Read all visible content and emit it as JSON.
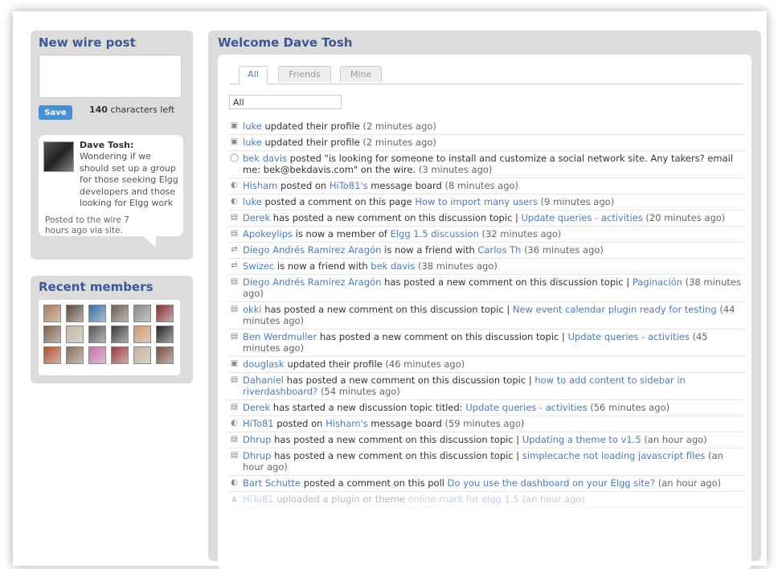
{
  "wire": {
    "title": "New wire post",
    "save_label": "Save",
    "char_count": "140",
    "char_label": "characters left",
    "post": {
      "author": "Dave Tosh:",
      "text": "Wondering if we should set up a group for those seeking Elgg developers and those looking for Elgg work",
      "meta": "Posted to the wire 7 hours ago via site."
    }
  },
  "members": {
    "title": "Recent members",
    "avatars": [
      "#a67b5b",
      "#5b4a3a",
      "#3a6ea5",
      "#6b5d4f",
      "#888888",
      "#8b2e2e",
      "#7a6048",
      "#c2b8a3",
      "#555555",
      "#3a3a3a",
      "#d09a6a",
      "#222222",
      "#b44d2e",
      "#8a6f5a",
      "#c96fa8",
      "#9a3a3a",
      "#c9b29a",
      "#7a4a3a"
    ]
  },
  "main": {
    "title": "Welcome Dave Tosh",
    "tabs": [
      "All",
      "Friends",
      "Mine"
    ],
    "filter_value": "All"
  },
  "feed": [
    {
      "icon": "profile-icon",
      "glyph": "▣",
      "parts": [
        {
          "l": "luke"
        },
        {
          "t": " updated their profile "
        },
        {
          "ts": "(2 minutes ago)"
        }
      ]
    },
    {
      "icon": "profile-icon",
      "glyph": "▣",
      "parts": [
        {
          "l": "luke"
        },
        {
          "t": " updated their profile "
        },
        {
          "ts": "(2 minutes ago)"
        }
      ]
    },
    {
      "icon": "wire-icon",
      "glyph": "◯",
      "parts": [
        {
          "l": "bek davis"
        },
        {
          "t": " posted \"is looking for someone to install and customize a social network site. Any takers? email me: bek@bekdavis.com\" on the wire. "
        },
        {
          "ts": "(3 minutes ago)"
        }
      ]
    },
    {
      "icon": "comment-icon",
      "glyph": "◐",
      "parts": [
        {
          "l": "Hisham"
        },
        {
          "t": " posted on "
        },
        {
          "l": "HiTo81's"
        },
        {
          "t": " message board "
        },
        {
          "ts": "(8 minutes ago)"
        }
      ]
    },
    {
      "icon": "comment-icon",
      "glyph": "◐",
      "parts": [
        {
          "l": "luke"
        },
        {
          "t": " posted a comment on this page "
        },
        {
          "l": "How to import many users"
        },
        {
          "t": " "
        },
        {
          "ts": "(9 minutes ago)"
        }
      ]
    },
    {
      "icon": "discussion-icon",
      "glyph": "▤",
      "parts": [
        {
          "l": "Derek"
        },
        {
          "t": " has posted a new comment on this discussion topic | "
        },
        {
          "l": "Update queries - activities"
        },
        {
          "t": " "
        },
        {
          "ts": "(20 minutes ago)"
        }
      ]
    },
    {
      "icon": "group-icon",
      "glyph": "▤",
      "parts": [
        {
          "l": "Apokeylips"
        },
        {
          "t": " is now a member of "
        },
        {
          "l": "Elgg 1.5 discussion"
        },
        {
          "t": " "
        },
        {
          "ts": "(32 minutes ago)"
        }
      ]
    },
    {
      "icon": "friend-icon",
      "glyph": "⇄",
      "parts": [
        {
          "l": "Diego Andrés Ramírez Aragón"
        },
        {
          "t": " is now a friend with "
        },
        {
          "l": "Carlos Th"
        },
        {
          "t": " "
        },
        {
          "ts": "(36 minutes ago)"
        }
      ]
    },
    {
      "icon": "friend-icon",
      "glyph": "⇄",
      "parts": [
        {
          "l": "Swizec"
        },
        {
          "t": " is now a friend with "
        },
        {
          "l": "bek davis"
        },
        {
          "t": " "
        },
        {
          "ts": "(38 minutes ago)"
        }
      ]
    },
    {
      "icon": "discussion-icon",
      "glyph": "▤",
      "parts": [
        {
          "l": "Diego Andrés Ramírez Aragón"
        },
        {
          "t": " has posted a new comment on this discussion topic | "
        },
        {
          "l": "Paginación"
        },
        {
          "t": " "
        },
        {
          "ts": "(38 minutes ago)"
        }
      ]
    },
    {
      "icon": "discussion-icon",
      "glyph": "▤",
      "parts": [
        {
          "l": "okki"
        },
        {
          "t": " has posted a new comment on this discussion topic | "
        },
        {
          "l": "New event calendar plugin ready for testing"
        },
        {
          "t": " "
        },
        {
          "ts": "(44 minutes ago)"
        }
      ]
    },
    {
      "icon": "discussion-icon",
      "glyph": "▤",
      "parts": [
        {
          "l": "Ben Werdmuller"
        },
        {
          "t": " has posted a new comment on this discussion topic | "
        },
        {
          "l": "Update queries - activities"
        },
        {
          "t": " "
        },
        {
          "ts": "(45 minutes ago)"
        }
      ]
    },
    {
      "icon": "profile-icon",
      "glyph": "▣",
      "parts": [
        {
          "l": "douglask"
        },
        {
          "t": " updated their profile "
        },
        {
          "ts": "(46 minutes ago)"
        }
      ]
    },
    {
      "icon": "discussion-icon",
      "glyph": "▤",
      "parts": [
        {
          "l": "Dahaniel"
        },
        {
          "t": " has posted a new comment on this discussion topic | "
        },
        {
          "l": "how to add content to sidebar in riverdashboard?"
        },
        {
          "t": " "
        },
        {
          "ts": "(54 minutes ago)"
        }
      ]
    },
    {
      "icon": "discussion-icon",
      "glyph": "▤",
      "parts": [
        {
          "l": "Derek"
        },
        {
          "t": " has started a new discussion topic titled: "
        },
        {
          "l": "Update queries - activities"
        },
        {
          "t": " "
        },
        {
          "ts": "(56 minutes ago)"
        }
      ]
    },
    {
      "icon": "comment-icon",
      "glyph": "◐",
      "parts": [
        {
          "l": "HiTo81"
        },
        {
          "t": " posted on "
        },
        {
          "l": "Hisham's"
        },
        {
          "t": " message board "
        },
        {
          "ts": "(59 minutes ago)"
        }
      ]
    },
    {
      "icon": "discussion-icon",
      "glyph": "▤",
      "parts": [
        {
          "l": "Dhrup"
        },
        {
          "t": " has posted a new comment on this discussion topic | "
        },
        {
          "l": "Updating a theme to v1.5"
        },
        {
          "t": " "
        },
        {
          "ts": "(an hour ago)"
        }
      ]
    },
    {
      "icon": "discussion-icon",
      "glyph": "▤",
      "parts": [
        {
          "l": "Dhrup"
        },
        {
          "t": " has posted a new comment on this discussion topic | "
        },
        {
          "l": "simplecache not loading javascript files"
        },
        {
          "t": " "
        },
        {
          "ts": "(an hour ago)"
        }
      ]
    },
    {
      "icon": "comment-icon",
      "glyph": "◐",
      "parts": [
        {
          "l": "Bart Schutte"
        },
        {
          "t": " posted a comment on this poll "
        },
        {
          "l": "Do you use the dashboard on your Elgg site?"
        },
        {
          "t": " "
        },
        {
          "ts": "(an hour ago)"
        }
      ]
    },
    {
      "icon": "plugin-icon",
      "glyph": "▲",
      "fade": true,
      "parts": [
        {
          "l": "HiTo81"
        },
        {
          "t": " uploaded a plugin or theme "
        },
        {
          "l": "online mark for elgg 1.5"
        },
        {
          "t": " "
        },
        {
          "ts": "(an hour ago)"
        }
      ]
    }
  ]
}
